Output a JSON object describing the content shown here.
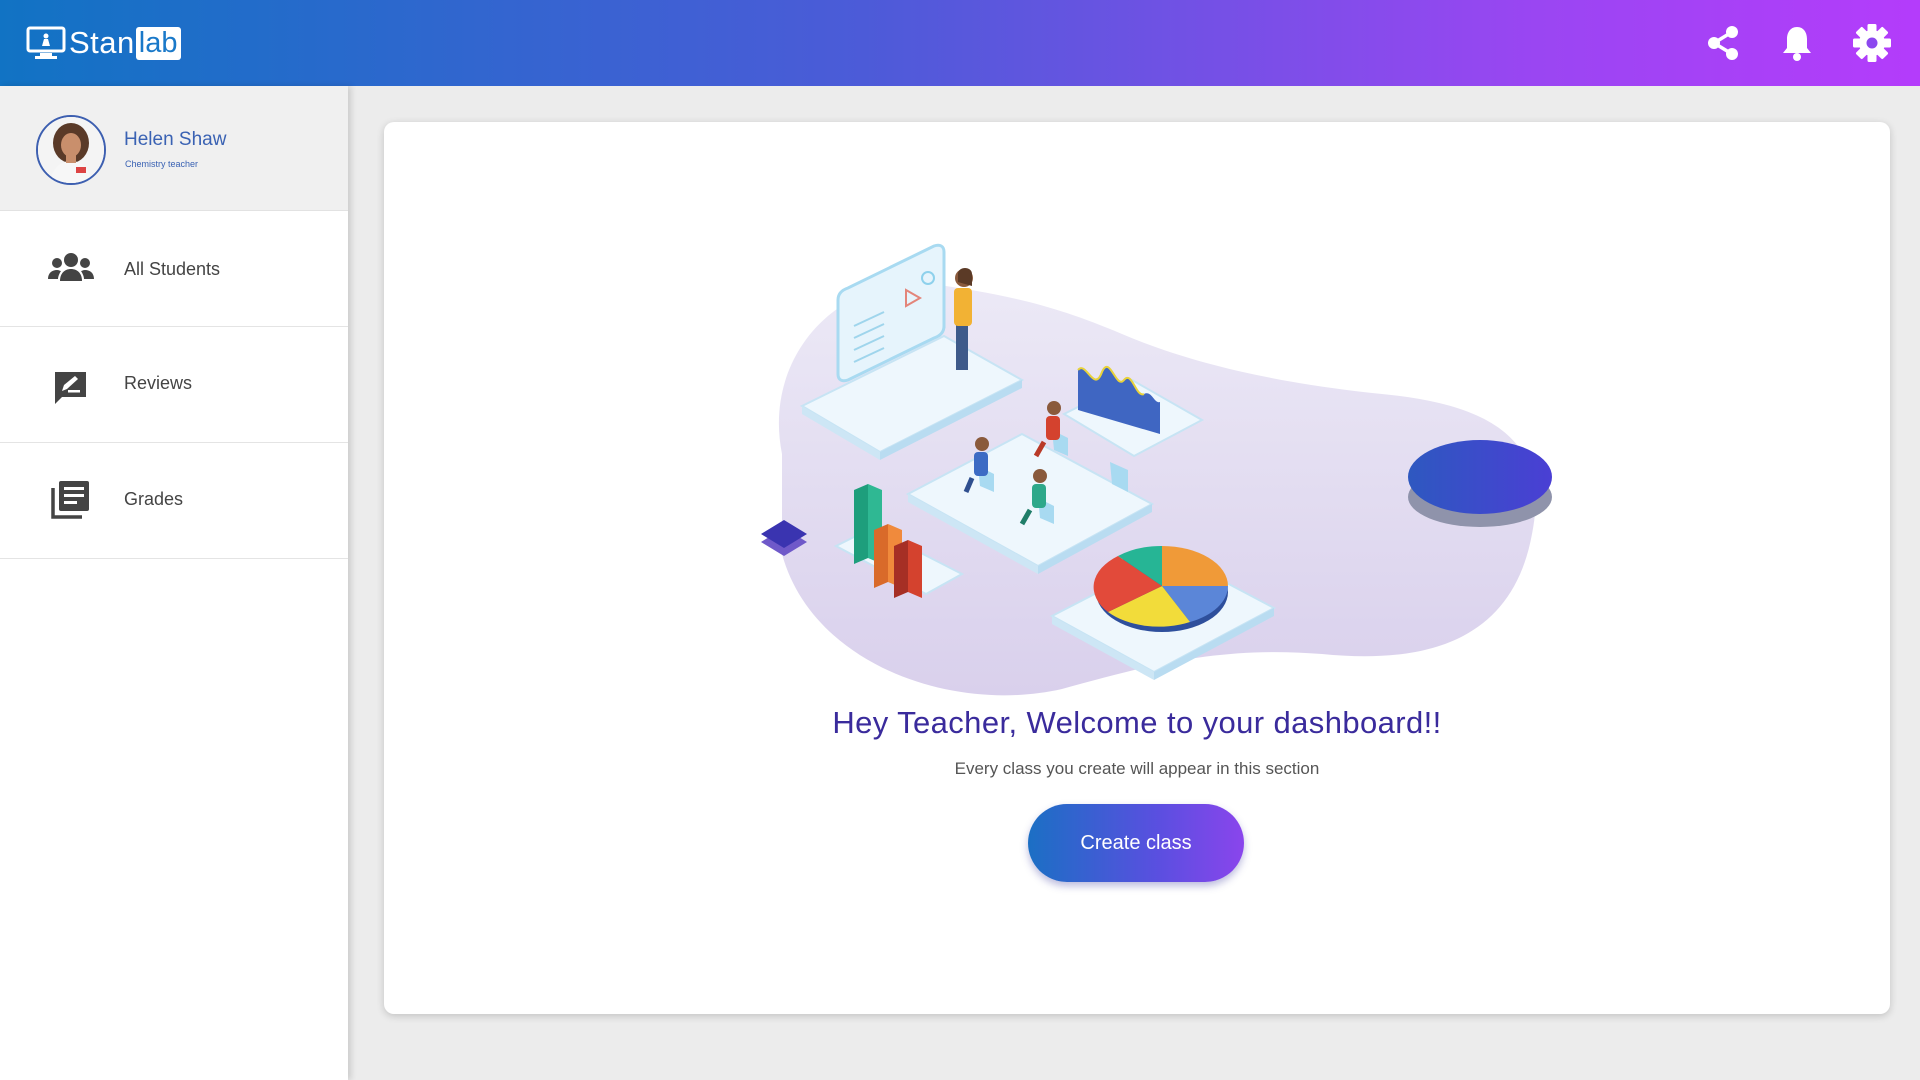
{
  "header": {
    "logo_part1": "Stan",
    "logo_part2": "lab",
    "icons": [
      "share-icon",
      "bell-icon",
      "gear-icon"
    ]
  },
  "profile": {
    "name": "Helen Shaw",
    "role": "Chemistry teacher"
  },
  "sidebar": {
    "items": [
      {
        "label": "All Students",
        "icon": "users-icon"
      },
      {
        "label": "Reviews",
        "icon": "review-icon"
      },
      {
        "label": "Grades",
        "icon": "grades-icon"
      }
    ]
  },
  "main": {
    "title": "Hey Teacher, Welcome to your dashboard!!",
    "subtitle": "Every class you create will appear in this section",
    "create_button": "Create class"
  },
  "colors": {
    "header_gradient_start": "#1173c4",
    "header_gradient_end": "#b43cfb",
    "title": "#3a2b9c",
    "accent": "#3a62b3"
  }
}
